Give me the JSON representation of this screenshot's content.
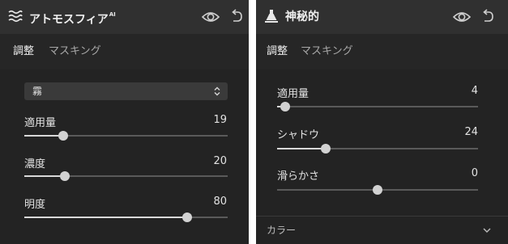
{
  "left_panel": {
    "title": "アトモスフィア",
    "title_badge": "AI",
    "icon": "waves-icon",
    "tabs": [
      {
        "label": "調整",
        "active": true
      },
      {
        "label": "マスキング",
        "active": false
      }
    ],
    "preset_dropdown": {
      "value": "霧",
      "icon": "updown-chevron-icon"
    },
    "sliders": [
      {
        "label": "適用量",
        "value": "19",
        "level": 0.19
      },
      {
        "label": "濃度",
        "value": "20",
        "level": 0.2
      },
      {
        "label": "明度",
        "value": "80",
        "level": 0.8
      }
    ]
  },
  "right_panel": {
    "title": "神秘的",
    "icon": "flask-icon",
    "tabs": [
      {
        "label": "調整",
        "active": true
      },
      {
        "label": "マスキング",
        "active": false
      }
    ],
    "sliders": [
      {
        "label": "適用量",
        "value": "4",
        "level": 0.04
      },
      {
        "label": "シャドウ",
        "value": "24",
        "level": 0.24
      },
      {
        "label": "滑らかさ",
        "value": "0",
        "level": 0.0,
        "bipolar": true
      }
    ],
    "footer_section": {
      "label": "カラー",
      "icon": "chevron-down-icon"
    }
  },
  "colors": {
    "panel_bg": "#232323",
    "header_bg": "#303030",
    "track": "#5a5a5a",
    "fill": "#d8d8d8",
    "thumb": "#d2d2d2"
  }
}
